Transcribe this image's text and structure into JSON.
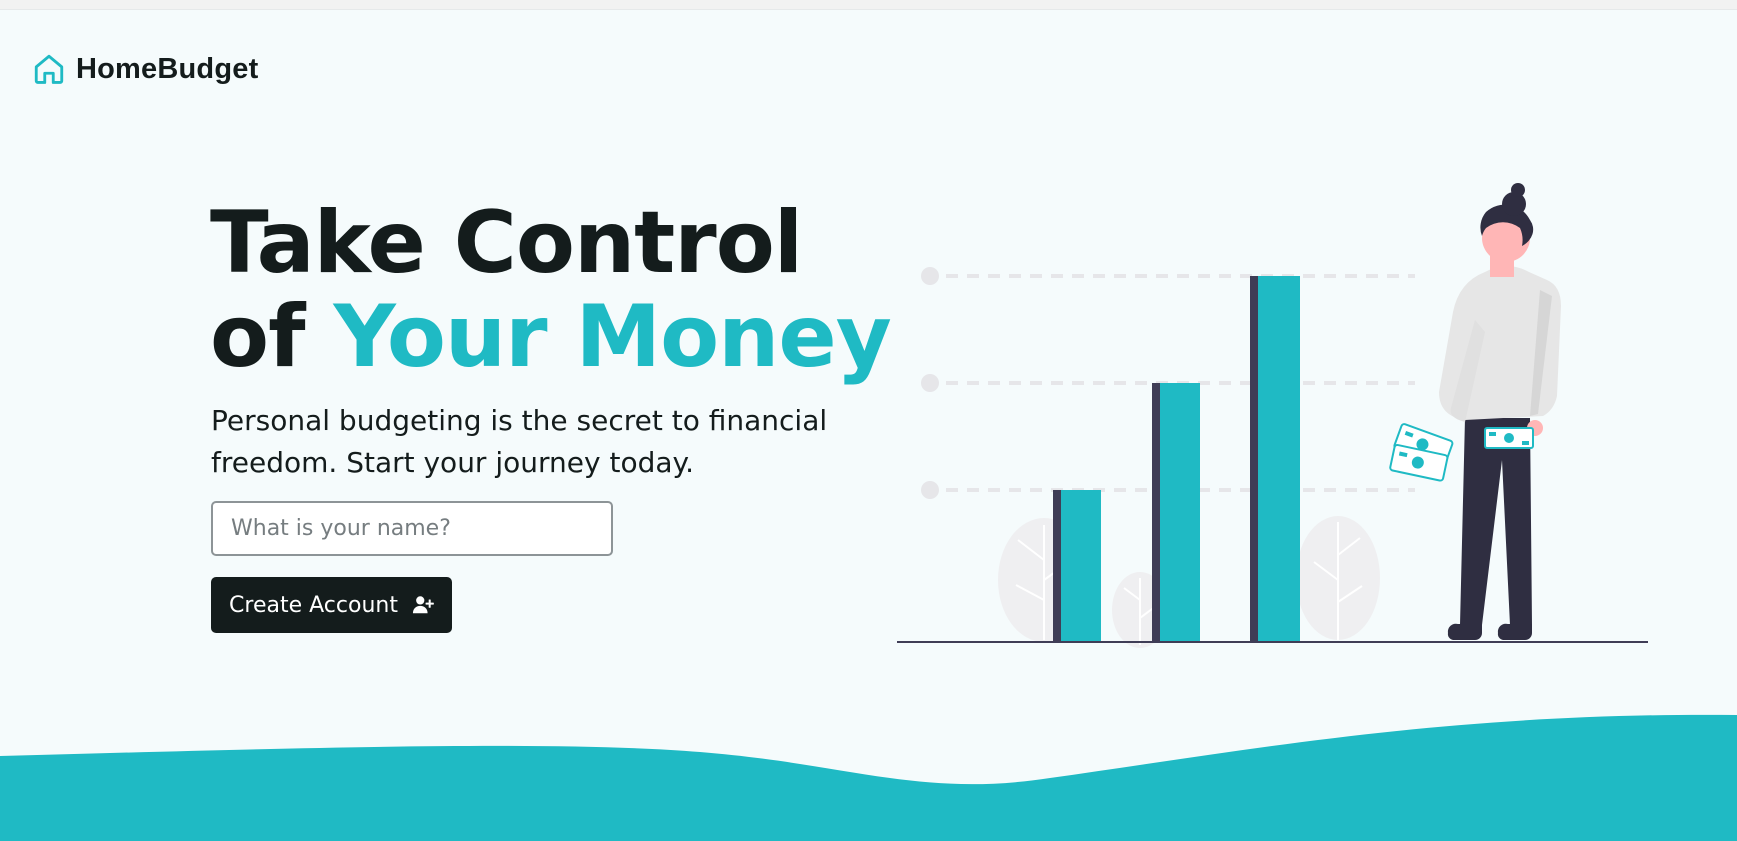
{
  "brand": {
    "name": "HomeBudget",
    "icon": "house-icon",
    "color": "#1fbac4"
  },
  "hero": {
    "title_line1": "Take Control",
    "title_line2_prefix": "of ",
    "title_line2_accent": "Your Money",
    "subtitle": "Personal budgeting is the secret to financial freedom. Start your journey today."
  },
  "form": {
    "name_placeholder": "What is your name?",
    "name_value": "",
    "submit_label": "Create Account",
    "submit_icon": "user-plus-icon"
  },
  "illustration": {
    "subject": "growth-bar-chart-with-woman-holding-money"
  },
  "colors": {
    "accent": "#1fbac4",
    "dark": "#141c1c",
    "background": "#f5fbfc"
  }
}
